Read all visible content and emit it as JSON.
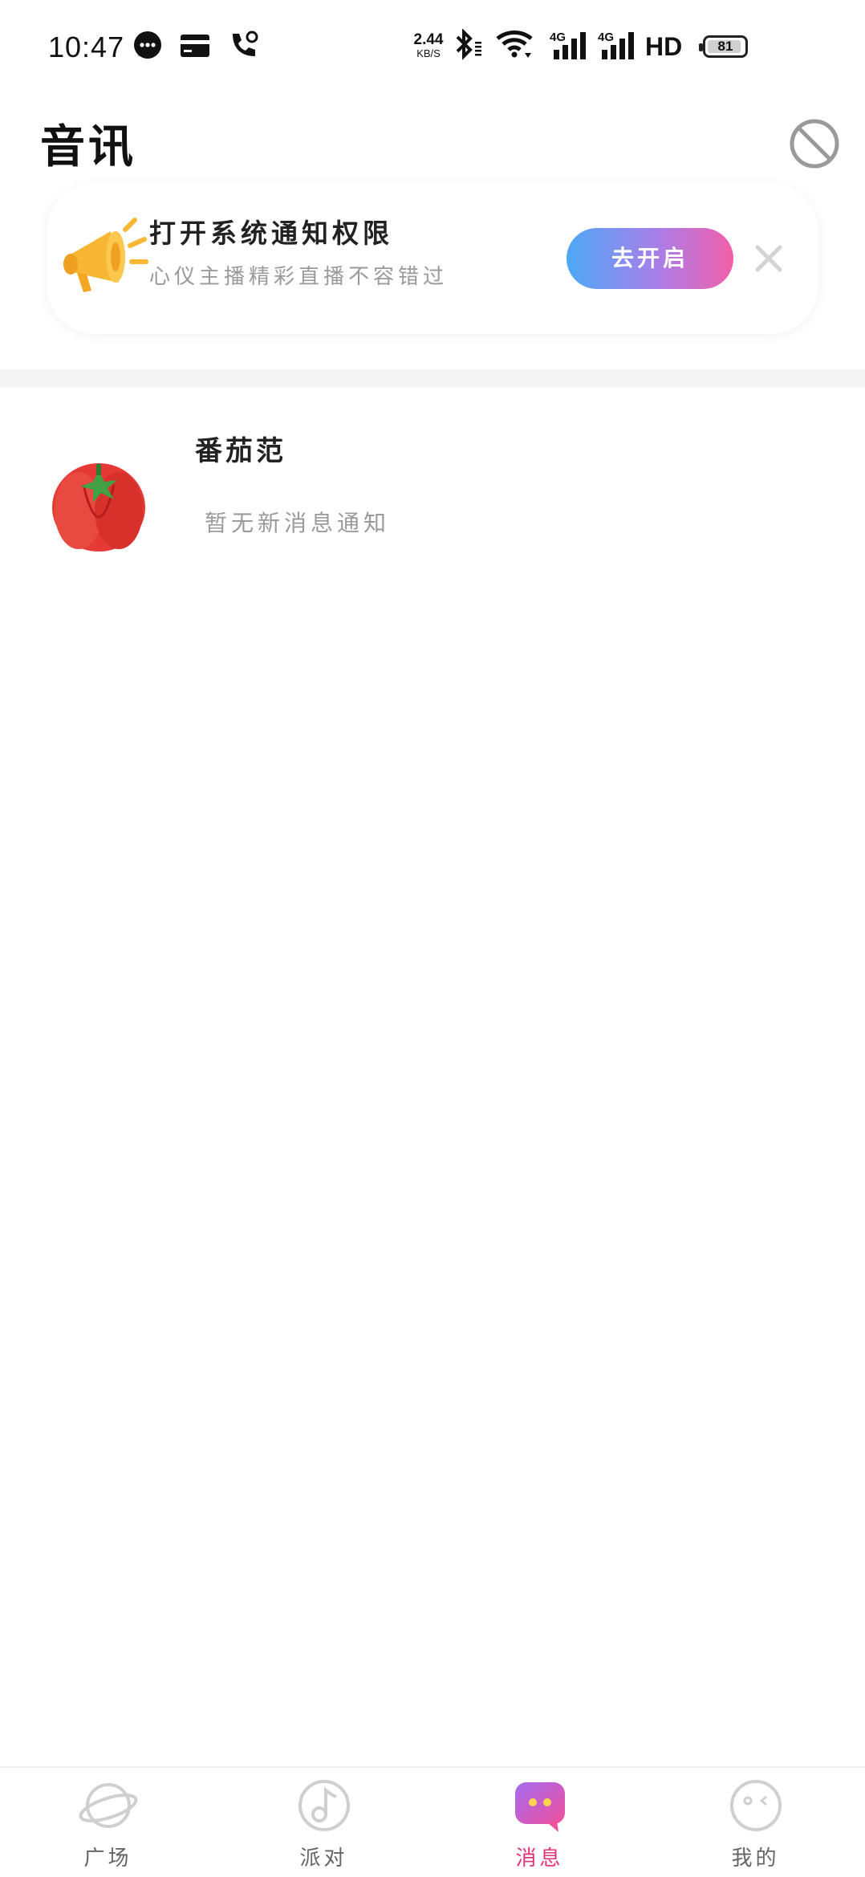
{
  "status_bar": {
    "time": "10:47",
    "net_speed_value": "2.44",
    "net_speed_unit": "KB/S",
    "signal1_label": "4G",
    "signal2_label": "4G",
    "hd_label": "HD",
    "battery_level": "81"
  },
  "header": {
    "title": "音讯"
  },
  "notification_banner": {
    "title": "打开系统通知权限",
    "subtitle": "心仪主播精彩直播不容错过",
    "button_label": "去开启"
  },
  "messages": [
    {
      "name": "番茄范",
      "preview": "暂无新消息通知"
    }
  ],
  "tab_bar": {
    "tabs": [
      {
        "label": "广场"
      },
      {
        "label": "派对"
      },
      {
        "label": "消息"
      },
      {
        "label": "我的"
      }
    ],
    "active_index": 2
  },
  "colors": {
    "accent_pink": "#e0337a",
    "button_gradient_start": "#4ea8f6",
    "button_gradient_end": "#f25fa8",
    "muted_text": "#9a9a9a"
  }
}
